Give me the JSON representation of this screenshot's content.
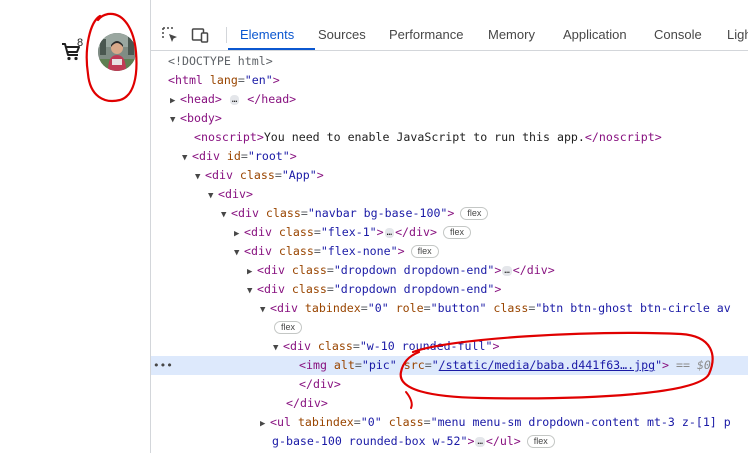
{
  "page": {
    "cart_badge": "8",
    "avatar_alt": "pic"
  },
  "devtools": {
    "tabs": [
      {
        "label": "Elements",
        "active": true
      },
      {
        "label": "Sources",
        "active": false
      },
      {
        "label": "Performance",
        "active": false
      },
      {
        "label": "Memory",
        "active": false
      },
      {
        "label": "Application",
        "active": false
      },
      {
        "label": "Console",
        "active": false
      },
      {
        "label": "Ligh",
        "active": false
      }
    ],
    "gutter_dots": "•••",
    "selected_suffix": "== $0",
    "badge_flex": "flex",
    "ellipsis": "…",
    "tree": {
      "doctype": "<!DOCTYPE html>",
      "html_open": "<html",
      "html_lang_attr": "lang",
      "html_lang_val": "\"en\"",
      "head": "head",
      "body": "body",
      "noscript_open": "<noscript>",
      "noscript_text": "You need to enable JavaScript to run this app.",
      "noscript_close": "</noscript>",
      "div": "div",
      "id_attr": "id",
      "root_val": "\"root\"",
      "class_attr": "class",
      "app_val": "\"App\"",
      "navbar_val": "\"navbar bg-base-100\"",
      "flex1_val": "\"flex-1\"",
      "flexnone_val": "\"flex-none\"",
      "dropdown_val": "\"dropdown dropdown-end\"",
      "tabindex_attr": "tabindex",
      "tabindex_val": "\"0\"",
      "role_attr": "role",
      "role_val": "\"button\"",
      "btn_val": "\"btn btn-ghost btn-circle av",
      "avatar_val": "\"w-10 rounded-full\"",
      "img": "img",
      "alt_attr": "alt",
      "alt_val": "\"pic\"",
      "src_attr": "src",
      "src_val": "/static/media/baba.d441f63….jpg",
      "ul": "ul",
      "menu_val": "\"menu menu-sm dropdown-content mt-3 z-[1] p",
      "menu_val_cont": "g-base-100 rounded-box w-52\""
    }
  },
  "colors": {
    "accent": "#0b57d0",
    "selected_row": "#dde9fc",
    "annotation": "#e00000",
    "tag": "#881280",
    "attr_name": "#994500",
    "attr_value": "#1a1aa6"
  }
}
